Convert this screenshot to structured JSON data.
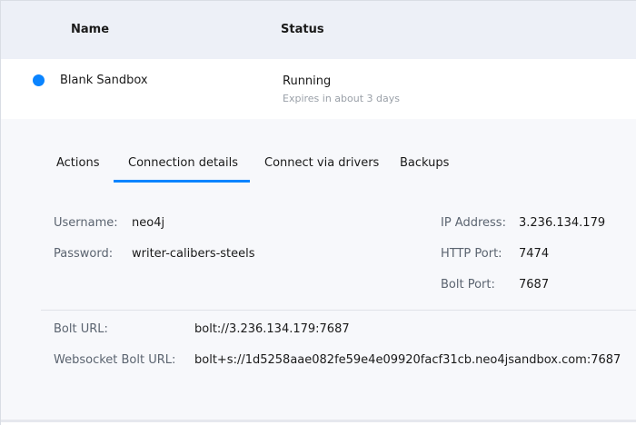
{
  "table": {
    "columns": {
      "name": "Name",
      "status": "Status"
    },
    "row": {
      "name": "Blank Sandbox",
      "status": "Running",
      "expires": "Expires in about 3 days",
      "status_color": "#0a84ff"
    }
  },
  "tabs": {
    "items": [
      "Actions",
      "Connection details",
      "Connect via drivers",
      "Backups"
    ],
    "active": "Connection details",
    "accent": "#0a84ff"
  },
  "connection": {
    "username_label": "Username:",
    "username": "neo4j",
    "password_label": "Password:",
    "password": "writer-calibers-steels",
    "ip_label": "IP Address:",
    "ip": "3.236.134.179",
    "http_port_label": "HTTP Port:",
    "http_port": "7474",
    "bolt_port_label": "Bolt Port:",
    "bolt_port": "7687",
    "bolt_url_label": "Bolt URL:",
    "bolt_url": "bolt://3.236.134.179:7687",
    "websocket_label": "Websocket Bolt URL:",
    "websocket_url": "bolt+s://1d5258aae082fe59e4e09920facf31cb.neo4jsandbox.com:7687"
  }
}
